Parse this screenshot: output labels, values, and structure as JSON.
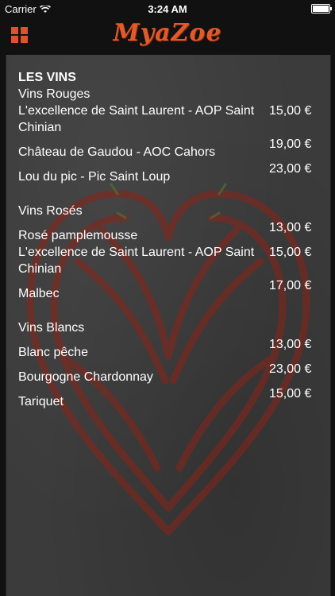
{
  "status": {
    "carrier": "Carrier",
    "time": "3:24 AM"
  },
  "nav": {
    "logo": "MyaZoe"
  },
  "menu": {
    "title": "LES VINS",
    "sections": [
      {
        "title": "Vins Rouges",
        "items": [
          {
            "name": "L'excellence de Saint Laurent - AOP Saint Chinian",
            "price": "15,00 €"
          },
          {
            "name": "Château de Gaudou - AOC Cahors",
            "price": "19,00 €"
          },
          {
            "name": "Lou du pic - Pic Saint Loup",
            "price": "23,00 €"
          }
        ]
      },
      {
        "title": "Vins Rosés",
        "items": [
          {
            "name": "Rosé pamplemousse",
            "price": "13,00 €"
          },
          {
            "name": "L'excellence de Saint Laurent - AOP Saint Chinian",
            "price": "15,00 €"
          },
          {
            "name": "Malbec",
            "price": "17,00 €"
          }
        ]
      },
      {
        "title": "Vins Blancs",
        "items": [
          {
            "name": "Blanc pêche",
            "price": "13,00 €"
          },
          {
            "name": "Bourgogne Chardonnay",
            "price": "23,00 €"
          },
          {
            "name": "Tariquet",
            "price": "15,00 €"
          }
        ]
      }
    ]
  },
  "colors": {
    "accent": "#e25a2a",
    "panel": "#3b3b3b"
  }
}
